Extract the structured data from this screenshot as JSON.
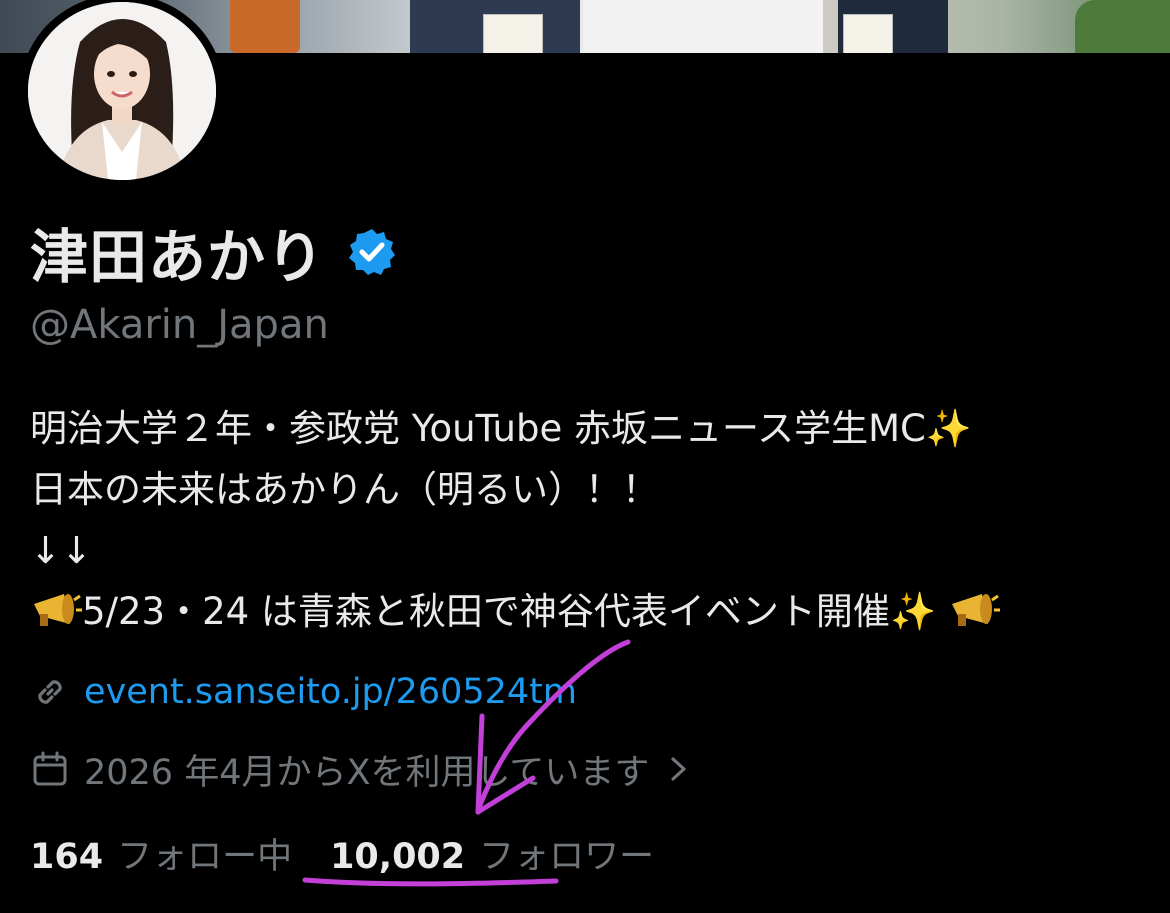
{
  "profile": {
    "display_name": "津田あかり",
    "handle": "@Akarin_Japan",
    "verified_icon": "verified-badge-icon",
    "bio": {
      "line1": "明治大学２年・参政党 YouTube 赤坂ニュース学生MC",
      "line2": "日本の未来はあかりん（明るい）！！",
      "line3": "↓↓",
      "line4": "5/23・24 は青森と秋田で神谷代表イベント開催"
    },
    "link": "event.sanseito.jp/260524tm",
    "joined": "2026 年4月からXを利用しています",
    "following_count": "164",
    "following_label": "フォロー中",
    "followers_count": "10,002",
    "followers_label": "フォロワー"
  },
  "colors": {
    "background": "#000000",
    "text_primary": "#e7e9ea",
    "text_secondary": "#71767b",
    "link": "#1d9bf0",
    "verified": "#1d9bf0",
    "annotation": "#c23fd8"
  },
  "icons": {
    "sparkles": "sparkles-icon",
    "megaphone": "megaphone-icon",
    "link": "link-icon",
    "calendar": "calendar-icon",
    "chevron": "chevron-right-icon"
  }
}
